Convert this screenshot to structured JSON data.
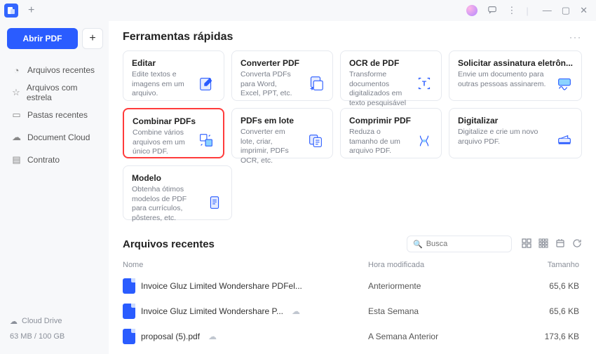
{
  "window": {
    "plus_tab": "+"
  },
  "sidebar": {
    "open_label": "Abrir PDF",
    "plus": "+",
    "items": [
      {
        "icon": "◔",
        "label": "Arquivos recentes"
      },
      {
        "icon": "☆",
        "label": "Arquivos com estrela"
      },
      {
        "icon": "▭",
        "label": "Pastas recentes"
      },
      {
        "icon": "☁",
        "label": "Document Cloud"
      },
      {
        "icon": "▤",
        "label": "Contrato"
      }
    ],
    "cloud_drive": "Cloud Drive",
    "storage": "63 MB / 100 GB"
  },
  "quicktools": {
    "title": "Ferramentas rápidas",
    "more": "···",
    "cards": [
      {
        "title": "Editar",
        "desc": "Edite textos e imagens em um arquivo."
      },
      {
        "title": "Converter PDF",
        "desc": "Converta PDFs para Word, Excel, PPT, etc."
      },
      {
        "title": "OCR de PDF",
        "desc": "Transforme documentos digitalizados em texto pesquisável ou editável."
      },
      {
        "title": "Solicitar assinatura eletrôn...",
        "desc": "Envie um documento para outras pessoas assinarem."
      },
      {
        "title": "Combinar PDFs",
        "desc": "Combine vários arquivos em um único PDF."
      },
      {
        "title": "PDFs em lote",
        "desc": "Converter em lote, criar, imprimir, PDFs OCR, etc."
      },
      {
        "title": "Comprimir PDF",
        "desc": "Reduza o tamanho de um arquivo PDF."
      },
      {
        "title": "Digitalizar",
        "desc": "Digitalize e crie um novo arquivo PDF."
      },
      {
        "title": "Modelo",
        "desc": "Obtenha ótimos modelos de PDF para currículos, pôsteres, etc."
      }
    ]
  },
  "recent": {
    "title": "Arquivos recentes",
    "search_placeholder": "Busca",
    "cols": {
      "name": "Nome",
      "modified": "Hora modificada",
      "size": "Tamanho"
    },
    "files": [
      {
        "name": "Invoice Gluz Limited Wondershare PDFel...",
        "modified": "Anteriormente",
        "size": "65,6 KB"
      },
      {
        "name": "Invoice Gluz Limited Wondershare P...",
        "modified": "Esta Semana",
        "size": "65,6 KB"
      },
      {
        "name": "proposal (5).pdf",
        "modified": "A Semana Anterior",
        "size": "173,6 KB"
      }
    ]
  }
}
